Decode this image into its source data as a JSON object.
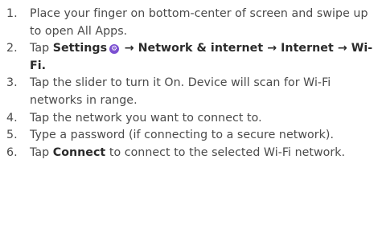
{
  "steps": [
    {
      "num": "1.",
      "text": "Place your finger on bottom-center of screen and swipe up to open All Apps."
    },
    {
      "num": "2.",
      "tap": "Tap ",
      "settings": "Settings",
      "path": "→ Network & internet → Internet → Wi-Fi.",
      "icon": "settings-gear-icon"
    },
    {
      "num": "3.",
      "text": "Tap the slider to turn it On. Device will scan for Wi-Fi networks in range."
    },
    {
      "num": "4.",
      "text": "Tap the network you want to connect to."
    },
    {
      "num": "5.",
      "text": "Type a password (if connecting to a secure network)."
    },
    {
      "num": "6.",
      "tap": "Tap ",
      "connect": "Connect",
      "rest": " to connect to the selected Wi-Fi network."
    }
  ],
  "colors": {
    "text": "#4a4a4a",
    "bold": "#2b2b2b",
    "icon": "#7b4fd1"
  }
}
